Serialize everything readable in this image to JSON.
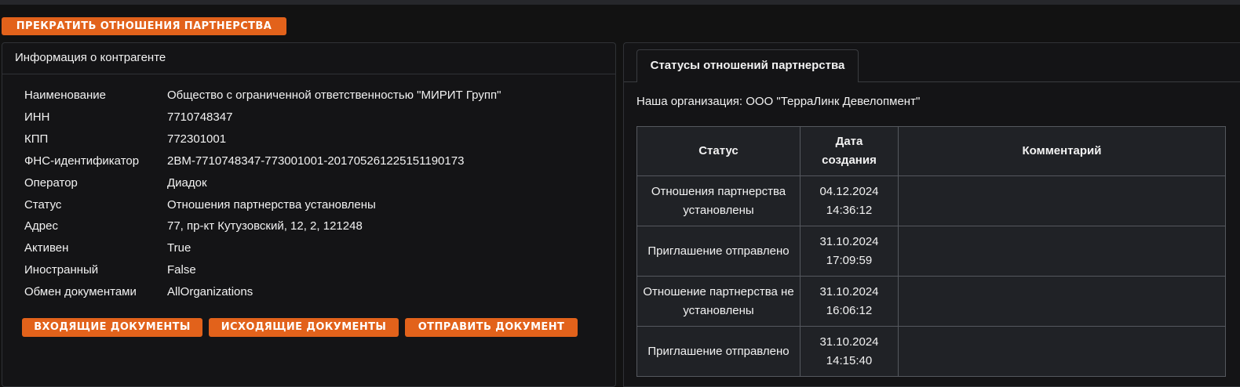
{
  "actions": {
    "terminate_label": "ПРЕКРАТИТЬ ОТНОШЕНИЯ ПАРТНЕРСТВА"
  },
  "counterparty": {
    "title": "Информация о контрагенте",
    "fields": [
      {
        "key": "Наименование",
        "value": "Общество с ограниченной ответственностью \"МИРИТ Групп\""
      },
      {
        "key": "ИНН",
        "value": "7710748347"
      },
      {
        "key": "КПП",
        "value": "772301001"
      },
      {
        "key": "ФНС-идентификатор",
        "value": "2BM-7710748347-773001001-201705261225151190173"
      },
      {
        "key": "Оператор",
        "value": "Диадок"
      },
      {
        "key": "Статус",
        "value": "Отношения партнерства установлены"
      },
      {
        "key": "Адрес",
        "value": "77, пр-кт Кутузовский, 12, 2, 121248"
      },
      {
        "key": "Активен",
        "value": "True"
      },
      {
        "key": "Иностранный",
        "value": "False"
      },
      {
        "key": "Обмен документами",
        "value": "AllOrganizations"
      }
    ],
    "buttons": {
      "incoming": "ВХОДЯЩИЕ ДОКУМЕНТЫ",
      "outgoing": "ИСХОДЯЩИЕ ДОКУМЕНТЫ",
      "send": "ОТПРАВИТЬ ДОКУМЕНТ"
    }
  },
  "statuses": {
    "tab_label": "Статусы отношений партнерства",
    "our_org": "Наша организация: ООО \"ТерраЛинк Девелопмент\"",
    "columns": [
      "Статус",
      "Дата создания",
      "Комментарий"
    ],
    "rows": [
      {
        "status": "Отношения партнерства установлены",
        "date": "04.12.2024",
        "time": "14:36:12",
        "comment": ""
      },
      {
        "status": "Приглашение отправлено",
        "date": "31.10.2024",
        "time": "17:09:59",
        "comment": ""
      },
      {
        "status": "Отношение партнерства не установлены",
        "date": "31.10.2024",
        "time": "16:06:12",
        "comment": ""
      },
      {
        "status": "Приглашение отправлено",
        "date": "31.10.2024",
        "time": "14:15:40",
        "comment": ""
      }
    ]
  }
}
